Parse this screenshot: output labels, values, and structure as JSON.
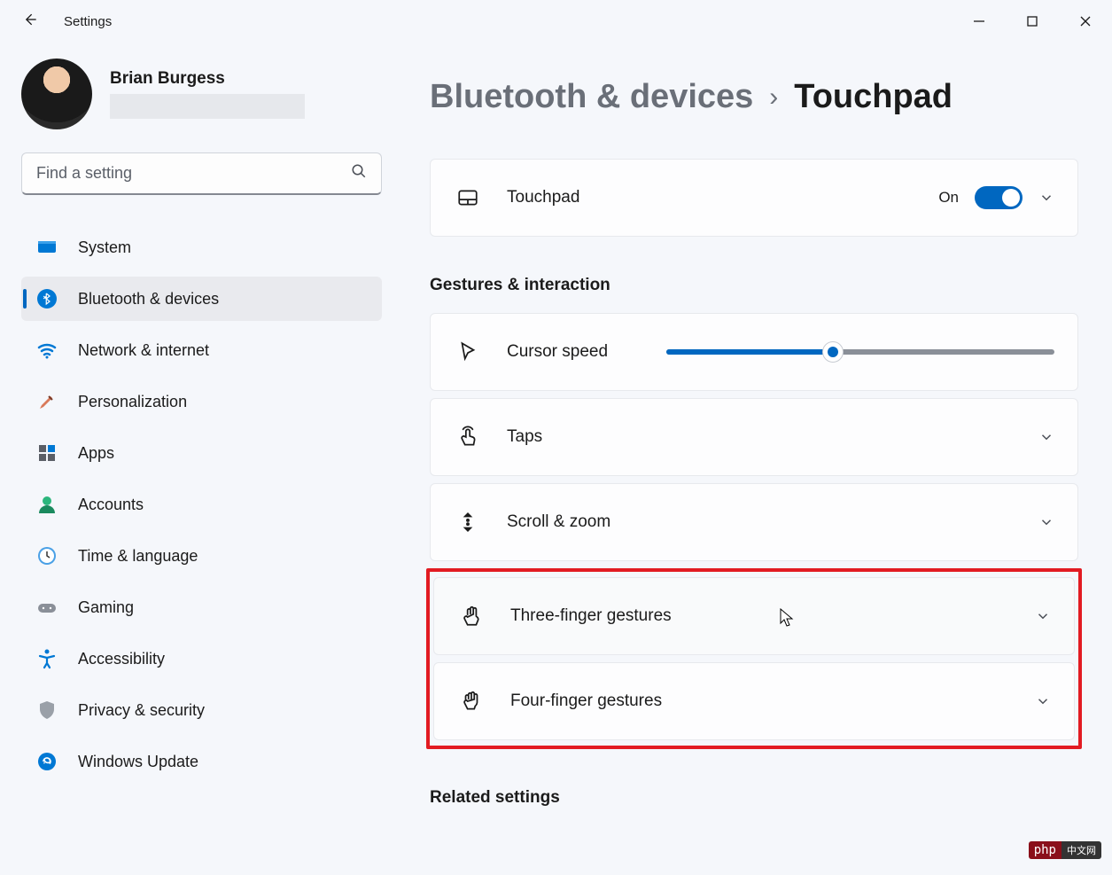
{
  "app": {
    "title": "Settings"
  },
  "profile": {
    "name": "Brian Burgess"
  },
  "search": {
    "placeholder": "Find a setting"
  },
  "nav": [
    {
      "id": "system",
      "label": "System"
    },
    {
      "id": "bluetooth",
      "label": "Bluetooth & devices",
      "selected": true
    },
    {
      "id": "network",
      "label": "Network & internet"
    },
    {
      "id": "personalization",
      "label": "Personalization"
    },
    {
      "id": "apps",
      "label": "Apps"
    },
    {
      "id": "accounts",
      "label": "Accounts"
    },
    {
      "id": "time",
      "label": "Time & language"
    },
    {
      "id": "gaming",
      "label": "Gaming"
    },
    {
      "id": "accessibility",
      "label": "Accessibility"
    },
    {
      "id": "privacy",
      "label": "Privacy & security"
    },
    {
      "id": "update",
      "label": "Windows Update"
    }
  ],
  "breadcrumb": {
    "parent": "Bluetooth & devices",
    "current": "Touchpad"
  },
  "touchpad": {
    "label": "Touchpad",
    "state_label": "On",
    "state": true
  },
  "section_gestures": "Gestures & interaction",
  "cursor_speed": {
    "label": "Cursor speed",
    "value_percent": 43
  },
  "taps": {
    "label": "Taps"
  },
  "scroll_zoom": {
    "label": "Scroll & zoom"
  },
  "three_finger": {
    "label": "Three-finger gestures"
  },
  "four_finger": {
    "label": "Four-finger gestures"
  },
  "section_related": "Related settings",
  "badge": {
    "php": "php",
    "cn": "中文网"
  }
}
